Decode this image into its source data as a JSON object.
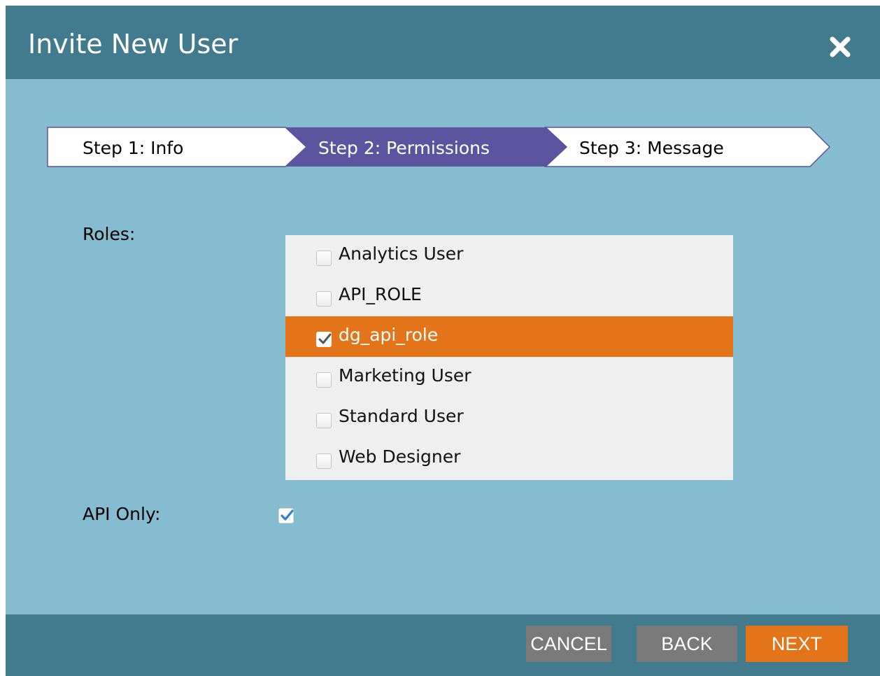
{
  "dialog": {
    "title": "Invite New User",
    "close_icon": "close-icon"
  },
  "steps": [
    {
      "label": "Step 1: Info",
      "state": "done"
    },
    {
      "label": "Step 2: Permissions",
      "state": "active"
    },
    {
      "label": "Step 3: Message",
      "state": "pending"
    }
  ],
  "roles": {
    "label": "Roles:",
    "items": [
      {
        "label": "Analytics User",
        "checked": false
      },
      {
        "label": "API_ROLE",
        "checked": false
      },
      {
        "label": "dg_api_role",
        "checked": true
      },
      {
        "label": "Marketing User",
        "checked": false
      },
      {
        "label": "Standard User",
        "checked": false
      },
      {
        "label": "Web Designer",
        "checked": false
      }
    ]
  },
  "api_only": {
    "label": "API Only:",
    "checked": true
  },
  "footer": {
    "cancel": "CANCEL",
    "back": "BACK",
    "next": "NEXT"
  },
  "colors": {
    "header": "#437b8e",
    "body": "#85bccf",
    "active_step": "#5b55a0",
    "accent": "#e37419",
    "gray_button": "#7a7a7a"
  }
}
